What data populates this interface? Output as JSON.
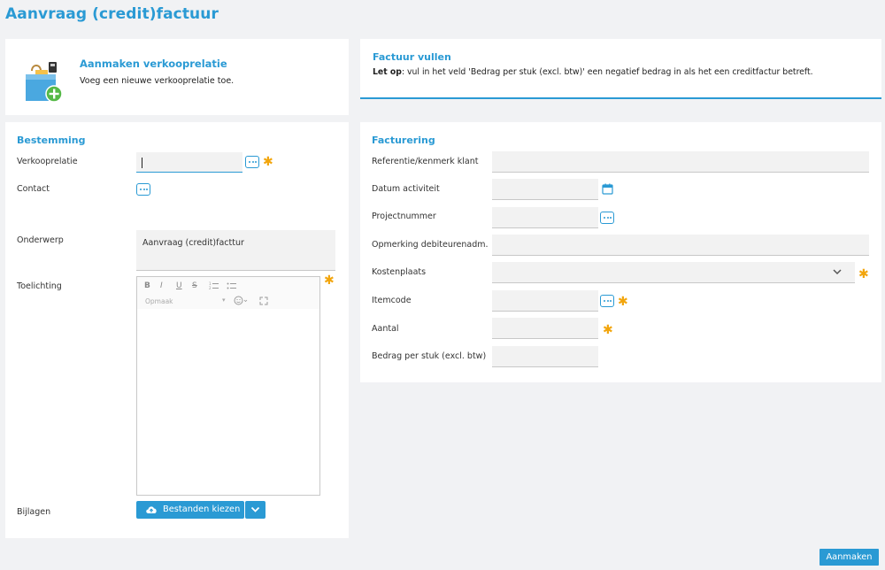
{
  "page": {
    "title": "Aanvraag (credit)factuur"
  },
  "intro": {
    "title": "Aanmaken verkooprelatie",
    "description": "Voeg een nieuwe verkooprelatie toe."
  },
  "notice": {
    "title": "Factuur vullen",
    "emphasis": "Let op",
    "text": ": vul in het veld 'Bedrag per stuk (excl. btw)' een negatief bedrag in als het een creditfactur betreft."
  },
  "destination": {
    "title": "Bestemming",
    "sales_relation_label": "Verkooprelatie",
    "contact_label": "Contact",
    "subject_label": "Onderwerp",
    "subject_value": "Aanvraag (credit)facttur",
    "explanation_label": "Toelichting",
    "attachments_label": "Bijlagen",
    "choose_files_label": "Bestanden kiezen",
    "editor_toolbar": {
      "bold": "B",
      "italic": "I",
      "underline": "U",
      "strike": "S",
      "format_select": "Opmaak"
    }
  },
  "invoicing": {
    "title": "Facturering",
    "reference_label": "Referentie/kenmerk klant",
    "activity_date_label": "Datum activiteit",
    "project_number_label": "Projectnummer",
    "debtor_remark_label": "Opmerking debiteurenadm.",
    "cost_center_label": "Kostenplaats",
    "item_code_label": "Itemcode",
    "quantity_label": "Aantal",
    "price_per_unit_label": "Bedrag per stuk (excl. btw)"
  },
  "actions": {
    "create_label": "Aanmaken"
  },
  "colors": {
    "accent": "#2a9ad4",
    "required": "#f2a50c",
    "background": "#f1f2f4",
    "field": "#f2f2f2"
  },
  "icons": [
    "ellipsis-icon",
    "calendar-icon",
    "chevron-down-icon",
    "cloud-upload-icon",
    "smiley-icon",
    "maximize-icon",
    "list-ordered-icon",
    "list-bulleted-icon",
    "required-asterisk-icon"
  ]
}
